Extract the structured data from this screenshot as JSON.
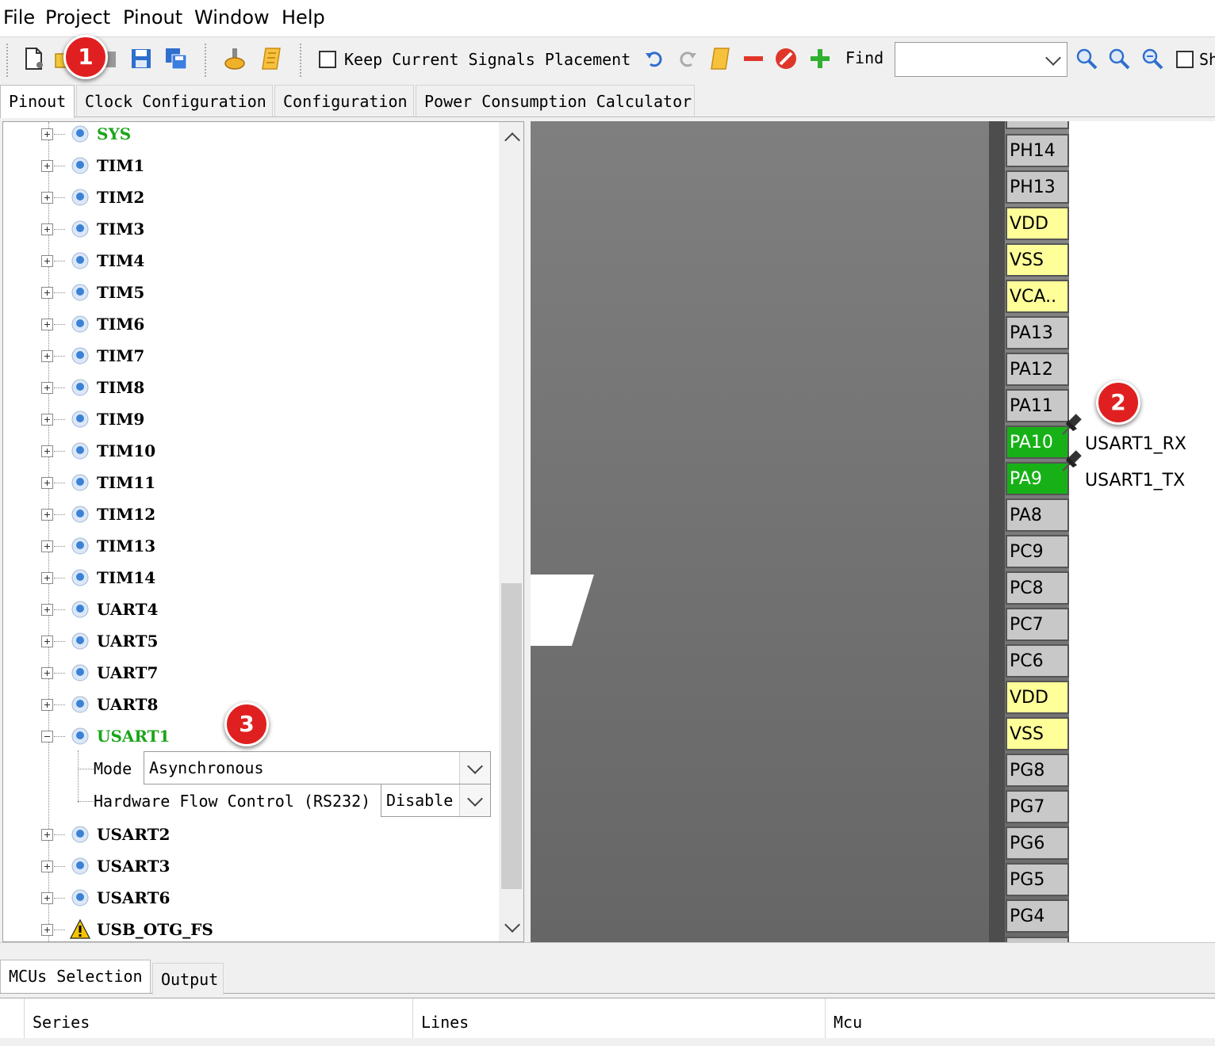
{
  "menu": [
    "File",
    "Project",
    "Pinout",
    "Window",
    "Help"
  ],
  "toolbar": {
    "keep_signals_label": "Keep Current Signals Placement",
    "find_label": "Find",
    "find_value": "",
    "trailing_label": "Sh"
  },
  "tabs": [
    "Pinout",
    "Clock Configuration",
    "Configuration",
    "Power Consumption Calculator"
  ],
  "tree": {
    "items": [
      "SYS",
      "TIM1",
      "TIM2",
      "TIM3",
      "TIM4",
      "TIM5",
      "TIM6",
      "TIM7",
      "TIM8",
      "TIM9",
      "TIM10",
      "TIM11",
      "TIM12",
      "TIM13",
      "TIM14",
      "UART4",
      "UART5",
      "UART7",
      "UART8",
      "USART1"
    ],
    "items_after": [
      "USART2",
      "USART3",
      "USART6",
      "USB_OTG_FS"
    ],
    "usart1": {
      "mode_label": "Mode",
      "mode_value": "Asynchronous",
      "hfc_label": "Hardware Flow Control (RS232)",
      "hfc_value": "Disable"
    }
  },
  "pins": [
    "PH14",
    "PH13",
    "VDD",
    "VSS",
    "VCA..",
    "PA13",
    "PA12",
    "PA11",
    "PA10",
    "PA9",
    "PA8",
    "PC9",
    "PC8",
    "PC7",
    "PC6",
    "VDD",
    "VSS",
    "PG8",
    "PG7",
    "PG6",
    "PG5",
    "PG4"
  ],
  "pin_signals": {
    "rx": "USART1_RX",
    "tx": "USART1_TX"
  },
  "badges": [
    "1",
    "2",
    "3"
  ],
  "bottom_tabs": [
    "MCUs Selection",
    "Output"
  ],
  "table_headers": [
    "Series",
    "Lines",
    "Mcu"
  ],
  "colors": {
    "active_green": "#17b117",
    "power_yellow": "#ffff99",
    "badge_red": "#e02020"
  }
}
